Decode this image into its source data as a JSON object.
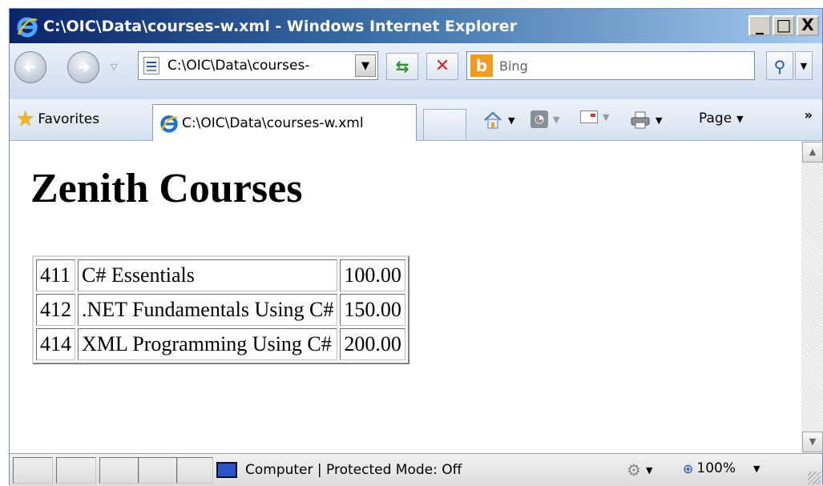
{
  "window": {
    "title": "C:\\OIC\\Data\\courses-w.xml - Windows Internet Explorer",
    "controls": {
      "minimize": "_",
      "maximize": "□",
      "close": "X"
    }
  },
  "address_bar": {
    "url": "C:\\OIC\\Data\\courses-",
    "search_placeholder": "Bing"
  },
  "command_bar": {
    "favorites_label": "Favorites",
    "tab_title": "C:\\OIC\\Data\\courses-w.xml",
    "page_menu": "Page",
    "more": "»"
  },
  "content": {
    "heading": "Zenith Courses",
    "courses": [
      {
        "id": "411",
        "title": "C# Essentials",
        "price": "100.00"
      },
      {
        "id": "412",
        "title": ".NET Fundamentals Using C#",
        "price": "150.00"
      },
      {
        "id": "414",
        "title": "XML Programming Using C#",
        "price": "200.00"
      }
    ]
  },
  "status_bar": {
    "zone_text": "Computer | Protected Mode: Off",
    "zoom": "100%"
  },
  "colors": {
    "titlebar_start": "#0a246a",
    "titlebar_end": "#a6caf0",
    "bing_orange": "#f39b1a"
  },
  "icons": [
    "ie-logo-icon",
    "back-arrow-icon",
    "forward-arrow-icon",
    "page-icon",
    "refresh-icon",
    "stop-icon",
    "bing-icon",
    "search-icon",
    "star-icon",
    "home-icon",
    "feeds-icon",
    "mail-icon",
    "print-icon",
    "computer-icon",
    "protected-mode-icon",
    "zoom-icon"
  ]
}
